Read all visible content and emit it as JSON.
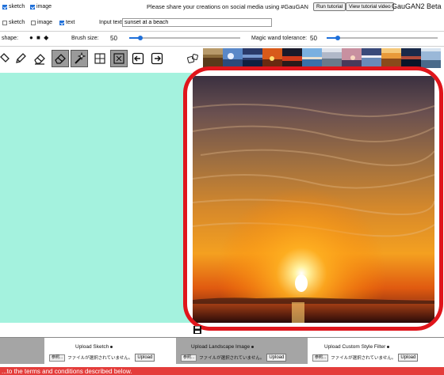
{
  "row1": {
    "checkboxes": [
      {
        "label": "sketch",
        "checked": true
      },
      {
        "label": "image",
        "checked": true
      }
    ],
    "share_text": "Please share your creations on social media using #GauGAN",
    "run_tutorial": "Run tutorial",
    "view_tutorial_video": "View tutorial video",
    "brand": "GauGAN2 Beta"
  },
  "row2": {
    "checkboxes": [
      {
        "label": "sketch",
        "checked": false
      },
      {
        "label": "image",
        "checked": false
      },
      {
        "label": "text",
        "checked": true
      }
    ],
    "input_label": "Input text:",
    "input_value": "sunset at a beach"
  },
  "row3": {
    "shape_label": "shape:",
    "shape_glyphs": "● ■ ◆",
    "brush_label": "Brush size:",
    "brush_value": "50",
    "brush_fraction": 0.1,
    "wand_label": "Magic wand tolerance:",
    "wand_value": "50",
    "wand_fraction": 0.1
  },
  "toolbar": {
    "tools": [
      "pencil-icon",
      "eraser-icon",
      "eraser-icon",
      "magic-wand-icon",
      "grid-icon",
      "grid-icon",
      "undo-arrow-icon",
      "redo-arrow-icon",
      "dice-icon"
    ],
    "thumbnail_count": 12
  },
  "panels": {
    "upload_sketch": "Upload Sketch",
    "upload_landscape": "Upload Landscape Image",
    "upload_style": "Upload Custom Style Filter",
    "browse": "参照...",
    "no_file": "ファイルが選択されていません。",
    "upload": "Upload"
  },
  "footer": {
    "terms": "...to the terms and conditions described below."
  },
  "colors": {
    "left_canvas": "#a4f2de",
    "frame": "#e0151b",
    "accent": "#1e6fd9",
    "footer": "#e43d3b"
  }
}
